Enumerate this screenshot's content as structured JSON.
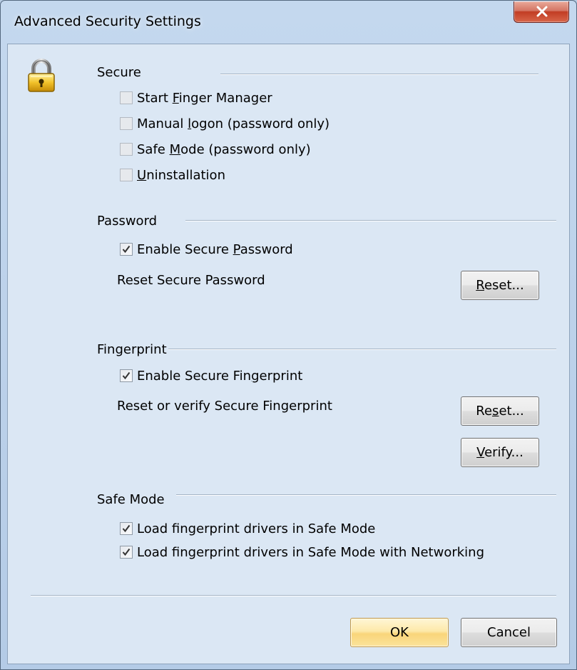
{
  "window": {
    "title": "Advanced Security Settings",
    "close_glyph": "X"
  },
  "icons": {
    "lock": "padlock-icon",
    "close": "close-icon"
  },
  "groups": {
    "secure": {
      "label": "Secure",
      "items": [
        {
          "pre": "Start ",
          "accel": "F",
          "post": "inger Manager",
          "checked": false,
          "enabled": false
        },
        {
          "pre": "Manual ",
          "accel": "l",
          "post": "ogon (password only)",
          "checked": false,
          "enabled": false
        },
        {
          "pre": "Safe ",
          "accel": "M",
          "post": "ode (password only)",
          "checked": false,
          "enabled": false
        },
        {
          "pre": "",
          "accel": "U",
          "post": "ninstallation",
          "checked": false,
          "enabled": false
        }
      ]
    },
    "password": {
      "label": "Password",
      "enable": {
        "pre": "Enable Secure ",
        "accel": "P",
        "post": "assword",
        "checked": true
      },
      "reset_text": "Reset Secure Password",
      "reset_button": {
        "pre": "",
        "accel": "R",
        "post": "eset..."
      }
    },
    "fingerprint": {
      "label": "Fingerprint",
      "enable": {
        "pre": "Enable Secure Fin",
        "accel": "g",
        "post": "erprint",
        "checked": true
      },
      "reset_text": "Reset or verify Secure Fingerprint",
      "reset_button": {
        "pre": "Re",
        "accel": "s",
        "post": "et..."
      },
      "verify_button": {
        "pre": "",
        "accel": "V",
        "post": "erify..."
      }
    },
    "safe_mode": {
      "label": "Safe Mode",
      "items": [
        {
          "text": "Load fingerprint drivers in Safe Mode",
          "checked": true
        },
        {
          "text": "Load fingerprint drivers in Safe Mode with Networking",
          "checked": true
        }
      ]
    }
  },
  "footer": {
    "ok": "OK",
    "cancel": "Cancel"
  },
  "colors": {
    "title_bar": "#b8cde4",
    "client_bg": "#dbe7f4",
    "close_button": "#c13c23",
    "default_button": "#f9d57a"
  }
}
